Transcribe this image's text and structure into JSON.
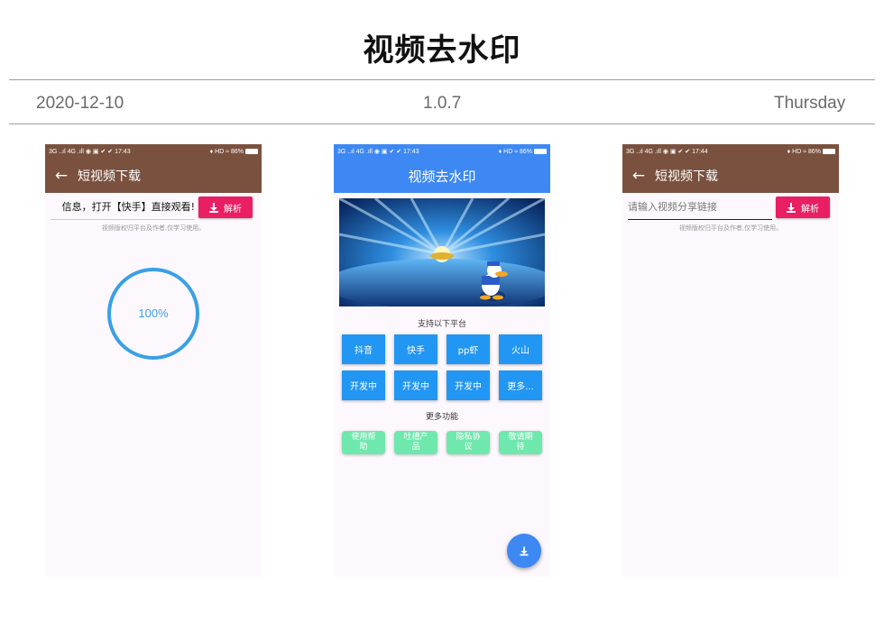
{
  "header": {
    "title": "视频去水印",
    "date": "2020-12-10",
    "version": "1.0.7",
    "weekday": "Thursday"
  },
  "screen1": {
    "status_left": "3G ..ıl 4G .ıll ◉ ▣ ✔ ✔   17:43",
    "status_right": "♦ HD ≈ 86%",
    "title": "短视频下载",
    "input_value": "信息，打开【快手】直接观看!",
    "parse_label": "解析",
    "disclaimer": "视频版权归平台及作者,仅学习使用。",
    "progress_text": "100%",
    "progress": 1.0
  },
  "screen2": {
    "status_left": "3G ..ıl 4G .ıll ◉ ▣ ✔ ✔   17:43",
    "status_right": "♦ HD ≈ 86%",
    "title": "视频去水印",
    "platforms_title": "支持以下平台",
    "platforms": [
      "抖音",
      "快手",
      "pp虾",
      "火山",
      "开发中",
      "开发中",
      "开发中",
      "更多..."
    ],
    "more_title": "更多功能",
    "features": [
      "使用帮助",
      "吐槽产品",
      "隐私协议",
      "敬请期待"
    ]
  },
  "screen3": {
    "status_left": "3G ..ıl 4G .ıll ◉ ▣ ✔ ✔   17:44",
    "status_right": "♦ HD ≈ 86%",
    "title": "短视频下载",
    "input_placeholder": "请输入视频分享链接",
    "parse_label": "解析",
    "disclaimer": "视频版权归平台及作者,仅学习使用。"
  },
  "icons": [
    "back-arrow-icon",
    "download-icon",
    "battery-icon"
  ],
  "colors": {
    "appbar_brown": "#7a513e",
    "appbar_blue": "#3d88f3",
    "parse_button": "#e91e63",
    "platform_button": "#2196f3",
    "feature_button": "#6fe8ae",
    "progress_ring": "#3aa0e6"
  }
}
